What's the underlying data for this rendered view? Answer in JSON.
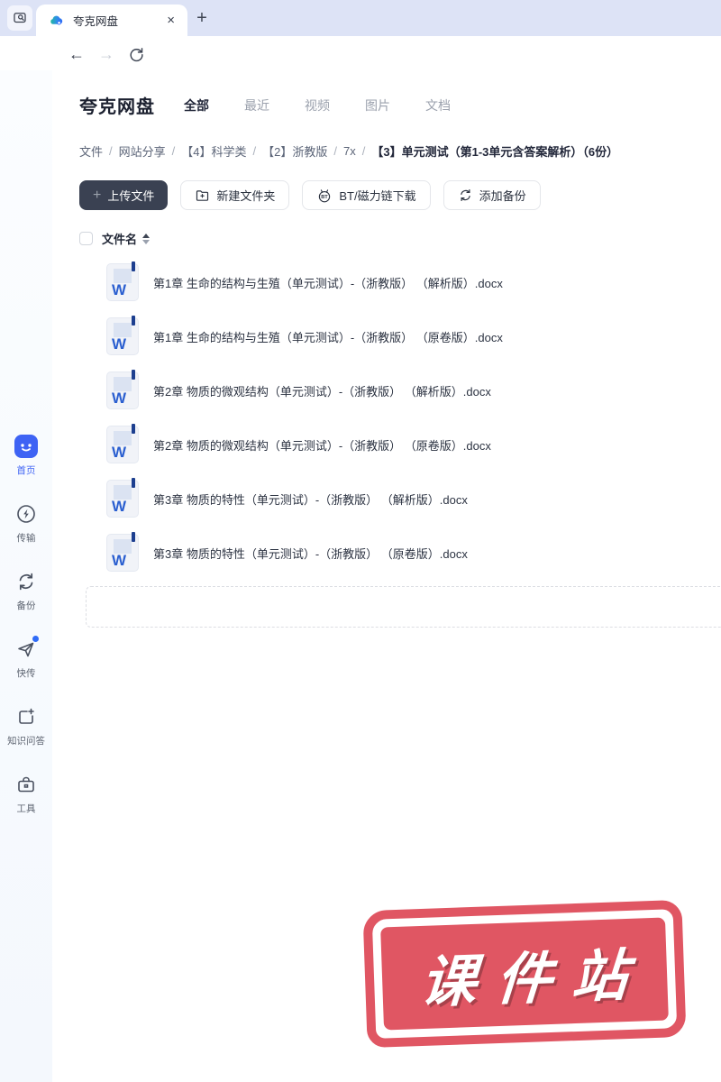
{
  "colors": {
    "accent_blue": "#3e63f4",
    "stamp_red": "#e05663",
    "upload_button_bg": "#3a4152",
    "word_icon_blue": "#2b5fd0",
    "tabbar_bg": "#dde3f6"
  },
  "browser": {
    "tab_title": "夸克网盘",
    "close_glyph": "×",
    "new_tab_glyph": "+",
    "back_glyph": "←",
    "forward_glyph": "→"
  },
  "header": {
    "title": "夸克网盘",
    "tabs": [
      {
        "label": "全部",
        "active": true
      },
      {
        "label": "最近",
        "active": false
      },
      {
        "label": "视频",
        "active": false
      },
      {
        "label": "图片",
        "active": false
      },
      {
        "label": "文档",
        "active": false
      }
    ]
  },
  "breadcrumb": {
    "separator": "/",
    "links": [
      "文件",
      "网站分享",
      "【4】科学类",
      "【2】浙教版",
      "7x"
    ],
    "current": "【3】单元测试（第1-3单元含答案解析）（6份）"
  },
  "toolbar": {
    "plus_glyph": "+",
    "upload": "上传文件",
    "new_folder": "新建文件夹",
    "bt": "BT/磁力链下载",
    "bt_icon_text": "BT",
    "backup": "添加备份"
  },
  "file_list": {
    "header": "文件名",
    "word_badge": "W",
    "files": [
      "第1章 生命的结构与生殖（单元测试）-（浙教版） （解析版）.docx",
      "第1章 生命的结构与生殖（单元测试）-（浙教版） （原卷版）.docx",
      "第2章 物质的微观结构（单元测试）-（浙教版） （解析版）.docx",
      "第2章 物质的微观结构（单元测试）-（浙教版） （原卷版）.docx",
      "第3章 物质的特性（单元测试）-（浙教版） （解析版）.docx",
      "第3章 物质的特性（单元测试）-（浙教版） （原卷版）.docx"
    ]
  },
  "sidebar": {
    "items": [
      {
        "label": "首页",
        "active": true
      },
      {
        "label": "传输",
        "active": false
      },
      {
        "label": "备份",
        "active": false
      },
      {
        "label": "快传",
        "active": false
      },
      {
        "label": "知识问答",
        "active": false
      },
      {
        "label": "工具",
        "active": false
      }
    ]
  },
  "stamp": {
    "text": "课件站"
  }
}
